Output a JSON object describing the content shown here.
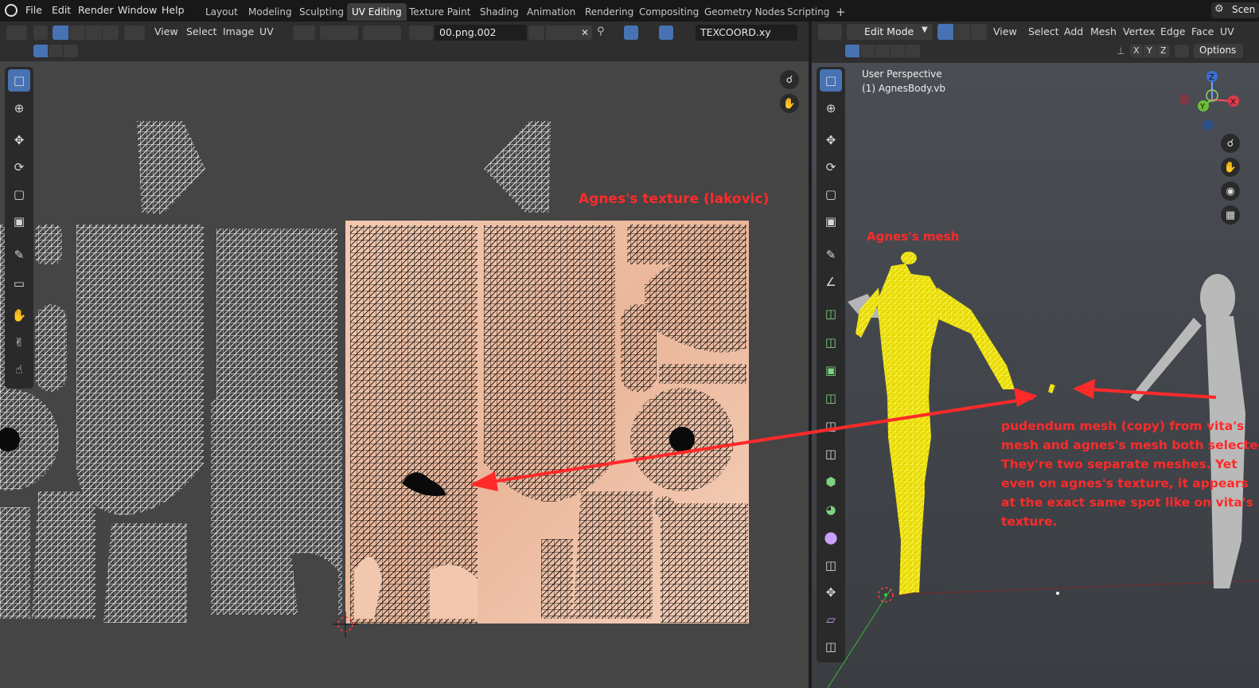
{
  "top_menu": {
    "items": [
      "File",
      "Edit",
      "Render",
      "Window",
      "Help"
    ],
    "workspaces": [
      "Layout",
      "Modeling",
      "Sculpting",
      "UV Editing",
      "Texture Paint",
      "Shading",
      "Animation",
      "Rendering",
      "Compositing",
      "Geometry Nodes",
      "Scripting"
    ],
    "active_workspace": "UV Editing",
    "add_tab": "+",
    "scene_label": "Scen"
  },
  "uv_editor": {
    "menu": [
      "View",
      "Select",
      "Image",
      "UV"
    ],
    "image_name": "00.png.002",
    "uv_map": "TEXCOORD.xy"
  },
  "viewport": {
    "mode": "Edit Mode",
    "menu": [
      "View",
      "Select",
      "Add",
      "Mesh",
      "Vertex",
      "Edge",
      "Face",
      "UV"
    ],
    "perspective": "User Perspective",
    "object": "(1) AgnesBody.vb",
    "axes": [
      "X",
      "Y",
      "Z"
    ],
    "options": "Options",
    "gizmo_axes": {
      "z": "Z",
      "y": "Y",
      "x": "X"
    }
  },
  "annotations": {
    "texture_label": "Agnes's texture (lakovic)",
    "mesh_label": "Agnes's mesh",
    "note_lines": [
      "pudendum mesh (copy) from vita's",
      "mesh and agnes's mesh both selected",
      "They're two separate meshes. Yet",
      "even on agnes's texture, it appears",
      "at the exact same spot like  on vita's",
      "texture."
    ]
  },
  "colors": {
    "accent": "#4772b3",
    "annotation": "#ff2a2a",
    "mesh": "#ffee00",
    "texture": "#efc3a9"
  }
}
